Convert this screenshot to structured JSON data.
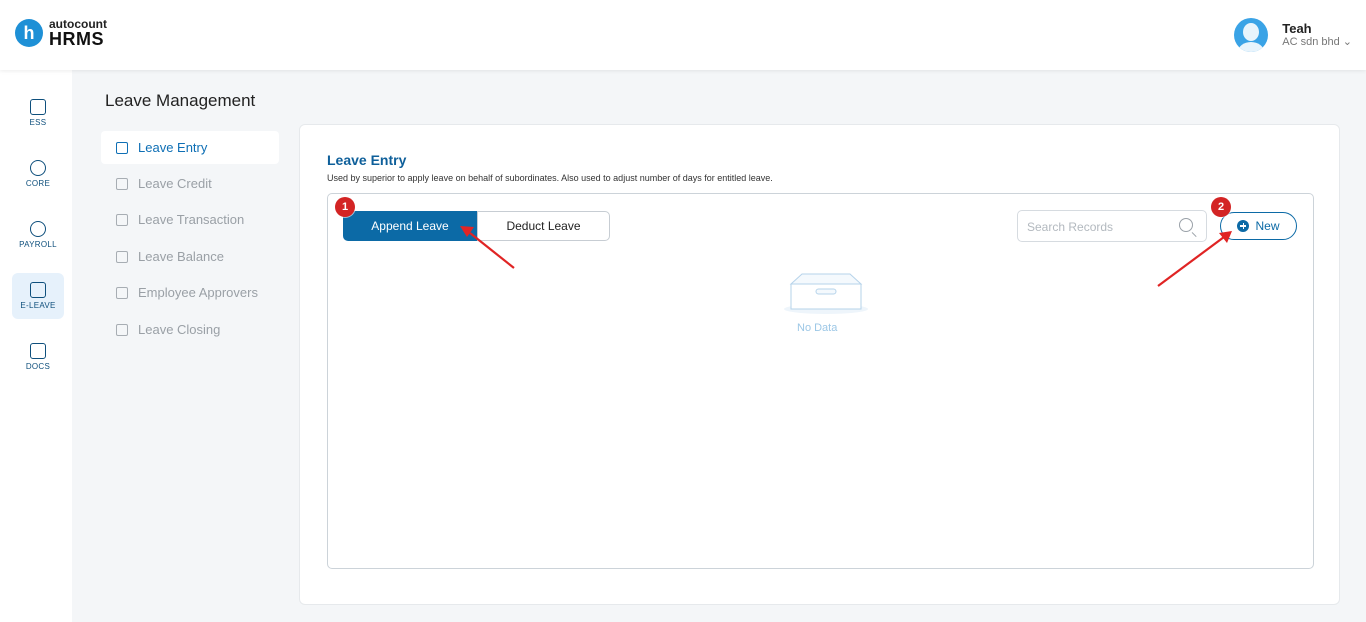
{
  "brand": {
    "small": "autocount",
    "big": "HRMS",
    "mark": "h"
  },
  "user": {
    "name": "Teah",
    "company": "AC sdn bhd",
    "caret": "⌄"
  },
  "rail": {
    "items": [
      {
        "label": "ESS",
        "icon": "id-card-icon"
      },
      {
        "label": "CORE",
        "icon": "cube-icon"
      },
      {
        "label": "PAYROLL",
        "icon": "dollar-icon"
      },
      {
        "label": "E-LEAVE",
        "icon": "calendar-icon",
        "active": true
      },
      {
        "label": "DOCS",
        "icon": "document-chart-icon"
      }
    ]
  },
  "section_title": "Leave Management",
  "subnav": {
    "items": [
      {
        "label": "Leave Entry",
        "active": true
      },
      {
        "label": "Leave Credit"
      },
      {
        "label": "Leave Transaction"
      },
      {
        "label": "Leave Balance"
      },
      {
        "label": "Employee Approvers"
      },
      {
        "label": "Leave Closing"
      }
    ]
  },
  "card": {
    "title": "Leave Entry",
    "description": "Used by superior to apply leave on behalf of subordinates. Also used to adjust number of days for entitled leave."
  },
  "segment": {
    "append": "Append Leave",
    "deduct": "Deduct Leave",
    "selected": "Append Leave"
  },
  "search": {
    "placeholder": "Search Records"
  },
  "new_button": {
    "label": "New"
  },
  "empty": {
    "text": "No Data"
  },
  "annotations": {
    "badge1": "1",
    "badge2": "2",
    "arrow_color": "#e02424"
  },
  "colors": {
    "primary": "#0c6aa6",
    "accent": "#1e90d6",
    "badge": "#d32424"
  }
}
